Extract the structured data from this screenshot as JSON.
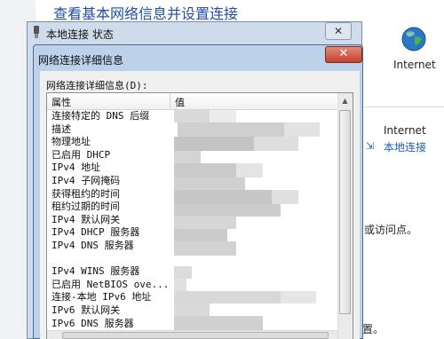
{
  "background": {
    "title": "查看基本网络信息并设置连接",
    "internet_label_1": "Internet",
    "internet_label_2": "Internet",
    "local_connection_link": "本地连接",
    "snippet_access": "或访问点。",
    "snippet_bottom": "置。"
  },
  "status_window": {
    "title": "本地连接 状态",
    "close_glyph": "✕"
  },
  "dialog": {
    "title": "网络连接详细信息",
    "close_glyph": "✕",
    "list_caption": "网络连接详细信息(D):",
    "columns": {
      "property": "属性",
      "value": "值"
    },
    "rows": [
      "连接特定的 DNS 后缀",
      "描述",
      "物理地址",
      "已启用 DHCP",
      "IPv4 地址",
      "IPv4 子网掩码",
      "获得租约的时间",
      "租约过期的时间",
      "IPv4 默认网关",
      "IPv4 DHCP 服务器",
      "IPv4 DNS 服务器",
      "",
      "IPv4 WINS 服务器",
      "已启用 NetBIOS ove...",
      "连接-本地 IPv6 地址",
      "IPv6 默认网关",
      "IPv6 DNS 服务器"
    ]
  },
  "icons": {
    "globe": "globe-icon",
    "network_adapter": "network-adapter-icon"
  },
  "colors": {
    "title_blue": "#1e4fa3",
    "dialog_frame": "#bcd1ea",
    "close_red": "#c4402b"
  }
}
